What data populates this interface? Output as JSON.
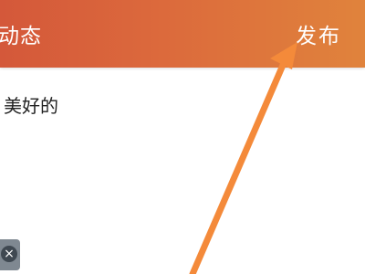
{
  "header": {
    "title": "动态",
    "publish_label": "发布",
    "gradient_start": "#d4583a",
    "gradient_end": "#e0833c"
  },
  "post": {
    "text": "美好的"
  },
  "attachment": {
    "close_icon": "close-icon",
    "close_glyph": "×"
  },
  "annotation": {
    "arrow_color": "#f48a3a"
  }
}
